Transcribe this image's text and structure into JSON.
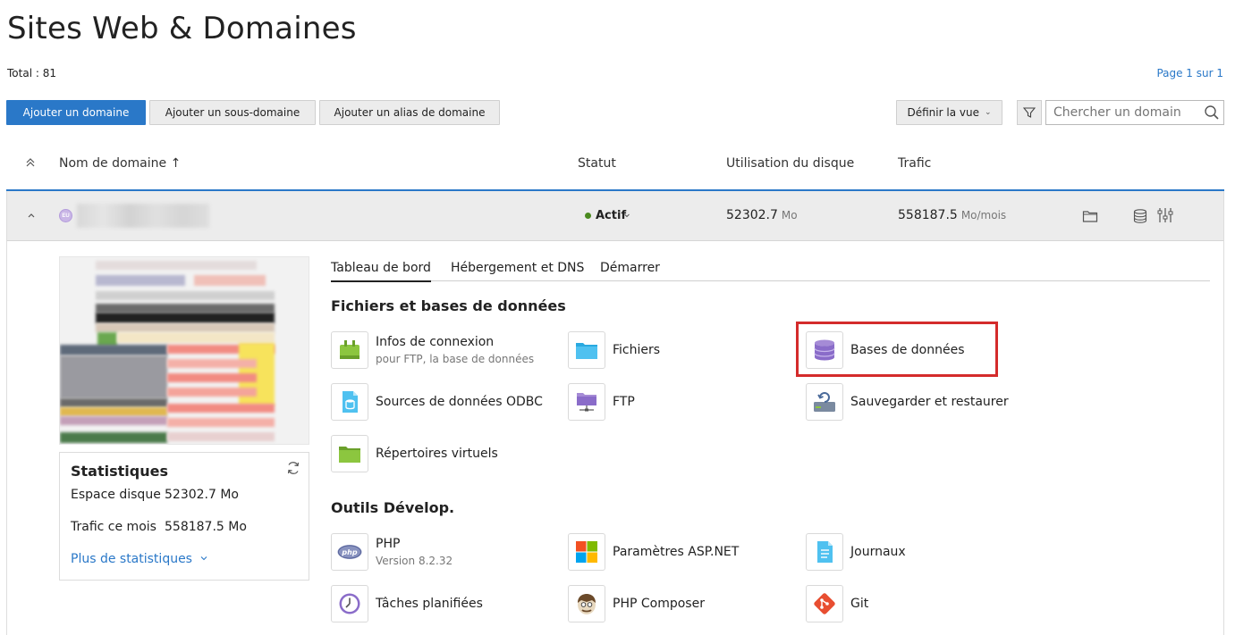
{
  "page": {
    "title": "Sites Web & Domaines",
    "total": "Total : 81",
    "pagination": "Page 1 sur 1"
  },
  "toolbar": {
    "add_domain": "Ajouter un domaine",
    "add_subdomain": "Ajouter un sous-domaine",
    "add_alias": "Ajouter un alias de domaine",
    "define_view": "Définir la vue",
    "search_placeholder": "Chercher un domain"
  },
  "table": {
    "headers": {
      "domain": "Nom de domaine ↑",
      "status": "Statut",
      "disk": "Utilisation du disque",
      "traffic": "Trafic"
    },
    "row": {
      "badge": "EU",
      "status": "Actif",
      "disk_value": "52302.7",
      "disk_unit": "Mo",
      "traffic_value": "558187.5",
      "traffic_unit": "Mo/mois"
    }
  },
  "stats": {
    "title": "Statistiques",
    "disk_label": "Espace disque",
    "disk_value": "52302.7 Mo",
    "traffic_label": "Trafic ce mois",
    "traffic_value": "558187.5 Mo",
    "more": "Plus de statistiques"
  },
  "tabs": [
    "Tableau de bord",
    "Hébergement et DNS",
    "Démarrer"
  ],
  "sections": {
    "files_db": "Fichiers et bases de données",
    "dev_tools": "Outils Dévelop."
  },
  "tools": {
    "connection_info": "Infos de connexion",
    "connection_info_sub": "pour FTP, la base de données",
    "files": "Fichiers",
    "databases": "Bases de données",
    "odbc": "Sources de données ODBC",
    "ftp": "FTP",
    "backup": "Sauvegarder et restaurer",
    "virtual_dirs": "Répertoires virtuels",
    "php": "PHP",
    "php_version": "Version 8.2.32",
    "aspnet": "Paramètres ASP.NET",
    "logs": "Journaux",
    "scheduled_tasks": "Tâches planifiées",
    "composer": "PHP Composer",
    "git": "Git"
  },
  "colors": {
    "accent": "#2a78c8",
    "status_active": "#4a8a1f",
    "highlight": "#d42b2b"
  }
}
